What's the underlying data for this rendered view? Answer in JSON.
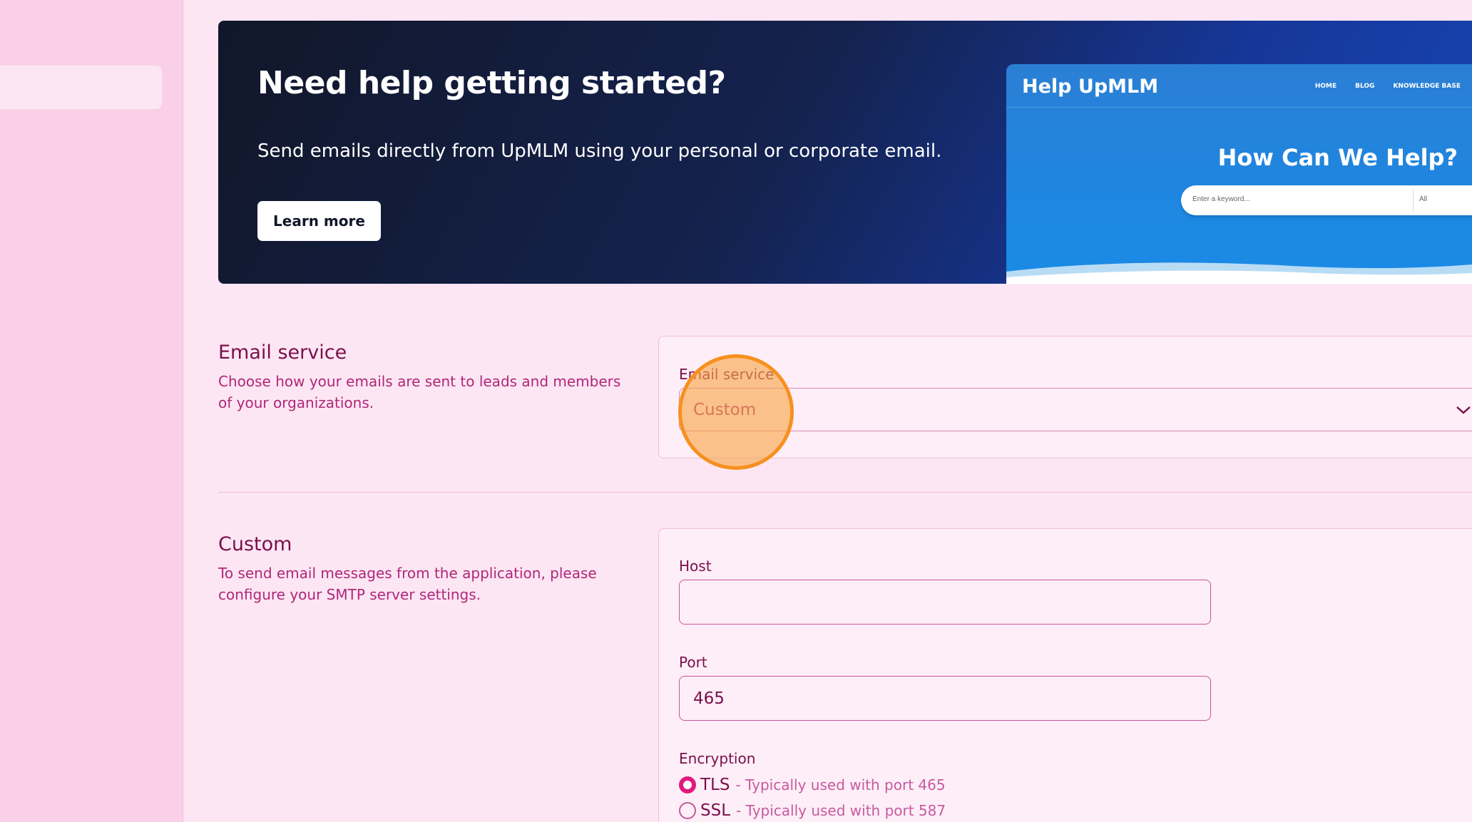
{
  "banner": {
    "title": "Need help getting started?",
    "text": "Send emails directly from UpMLM using your personal or corporate email.",
    "button_label": "Learn more",
    "preview": {
      "logo": "Help UpMLM",
      "nav": [
        "HOME",
        "BLOG",
        "KNOWLEDGE BASE"
      ],
      "headline": "How Can We Help?",
      "search_placeholder": "Enter a keyword...",
      "search_select": "All"
    }
  },
  "email_service_section": {
    "title": "Email service",
    "description": "Choose how your emails are sent to leads and members of your organizations.",
    "field_label": "Email service",
    "selected_value": "Custom"
  },
  "custom_section": {
    "title": "Custom",
    "description": "To send email messages from the application, please configure your SMTP server settings.",
    "host_label": "Host",
    "host_value": "",
    "port_label": "Port",
    "port_value": "465",
    "encryption_label": "Encryption",
    "encryption_options": [
      {
        "label": "TLS",
        "hint": "- Typically used with port 465",
        "checked": true
      },
      {
        "label": "SSL",
        "hint": "- Typically used with port 587",
        "checked": false
      }
    ]
  },
  "colors": {
    "accent": "#e0197d",
    "text": "#7a0f4b",
    "background": "#fde6f3",
    "click_indicator": "#f7901e"
  }
}
